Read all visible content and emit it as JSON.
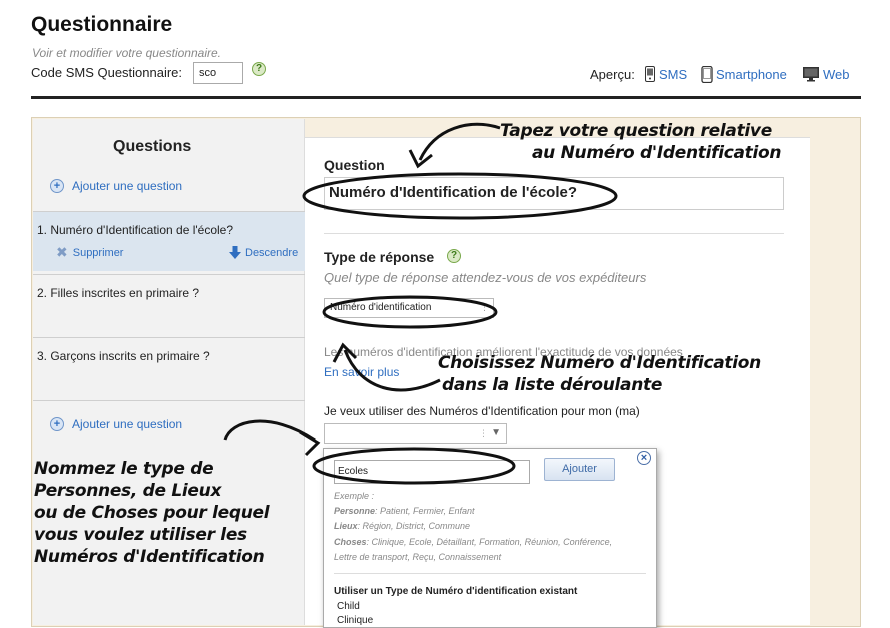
{
  "header": {
    "title": "Questionnaire",
    "subtitle": "Voir et modifier votre questionnaire.",
    "sms_code_label": "Code SMS Questionnaire:",
    "sms_code_value": "sco",
    "preview_label": "Aperçu:",
    "preview_links": [
      "SMS",
      "Smartphone",
      "Web"
    ]
  },
  "sidebar": {
    "title": "Questions",
    "add_question": "Ajouter une question",
    "items": [
      {
        "label": "1.  Numéro d'Identification de l'école?"
      },
      {
        "label": "2.  Filles inscrites en primaire ?"
      },
      {
        "label": "3.  Garçons inscrits en primaire ?"
      }
    ],
    "delete_label": "Supprimer",
    "move_down_label": "Descendre"
  },
  "editor": {
    "question_label": "Question",
    "question_value": "Numéro d'Identification de l'école?",
    "response_type_label": "Type de réponse",
    "response_type_hint": "Quel type de réponse attendez-vous de vos expéditeurs",
    "response_type_value": "Numéro d'identification",
    "id_note": "Les numéros d'identification améliorent l'exactitude de vos données",
    "learn_more": "En savoir plus",
    "use_ids_label": "Je veux utiliser des Numéros d'Identification pour mon (ma)"
  },
  "popup": {
    "new_type_value": "Ecoles",
    "add_button": "Ajouter",
    "example_title": "Exemple :",
    "examples": [
      {
        "key": "Personne",
        "value": ": Patient, Fermier, Enfant"
      },
      {
        "key": "Lieux",
        "value": ": Région, District, Commune"
      },
      {
        "key": "Choses",
        "value": ": Clinique, Ecole, Détaillant, Formation, Réunion, Conférence,"
      }
    ],
    "examples_cont": "Lettre de transport, Reçu, Connaissement",
    "existing_title": "Utiliser un Type de Numéro d'identification existant",
    "existing_items": [
      "Child",
      "Clinique"
    ]
  },
  "annotations": {
    "top": [
      "Tapez votre question relative",
      "au Numéro d'Identification"
    ],
    "middle": [
      "Choisissez Numéro d'Identification",
      "dans la liste déroulante"
    ],
    "left": [
      "Nommez le type de",
      "Personnes, de Lieux",
      "ou de Choses pour lequel",
      "vous voulez utiliser les",
      "Numéros d'Identification"
    ]
  },
  "colors": {
    "link": "#2f6ec0",
    "panel": "#f7efe0",
    "sidebar": "#f2f2f2",
    "active_row": "#dbe5ef"
  }
}
